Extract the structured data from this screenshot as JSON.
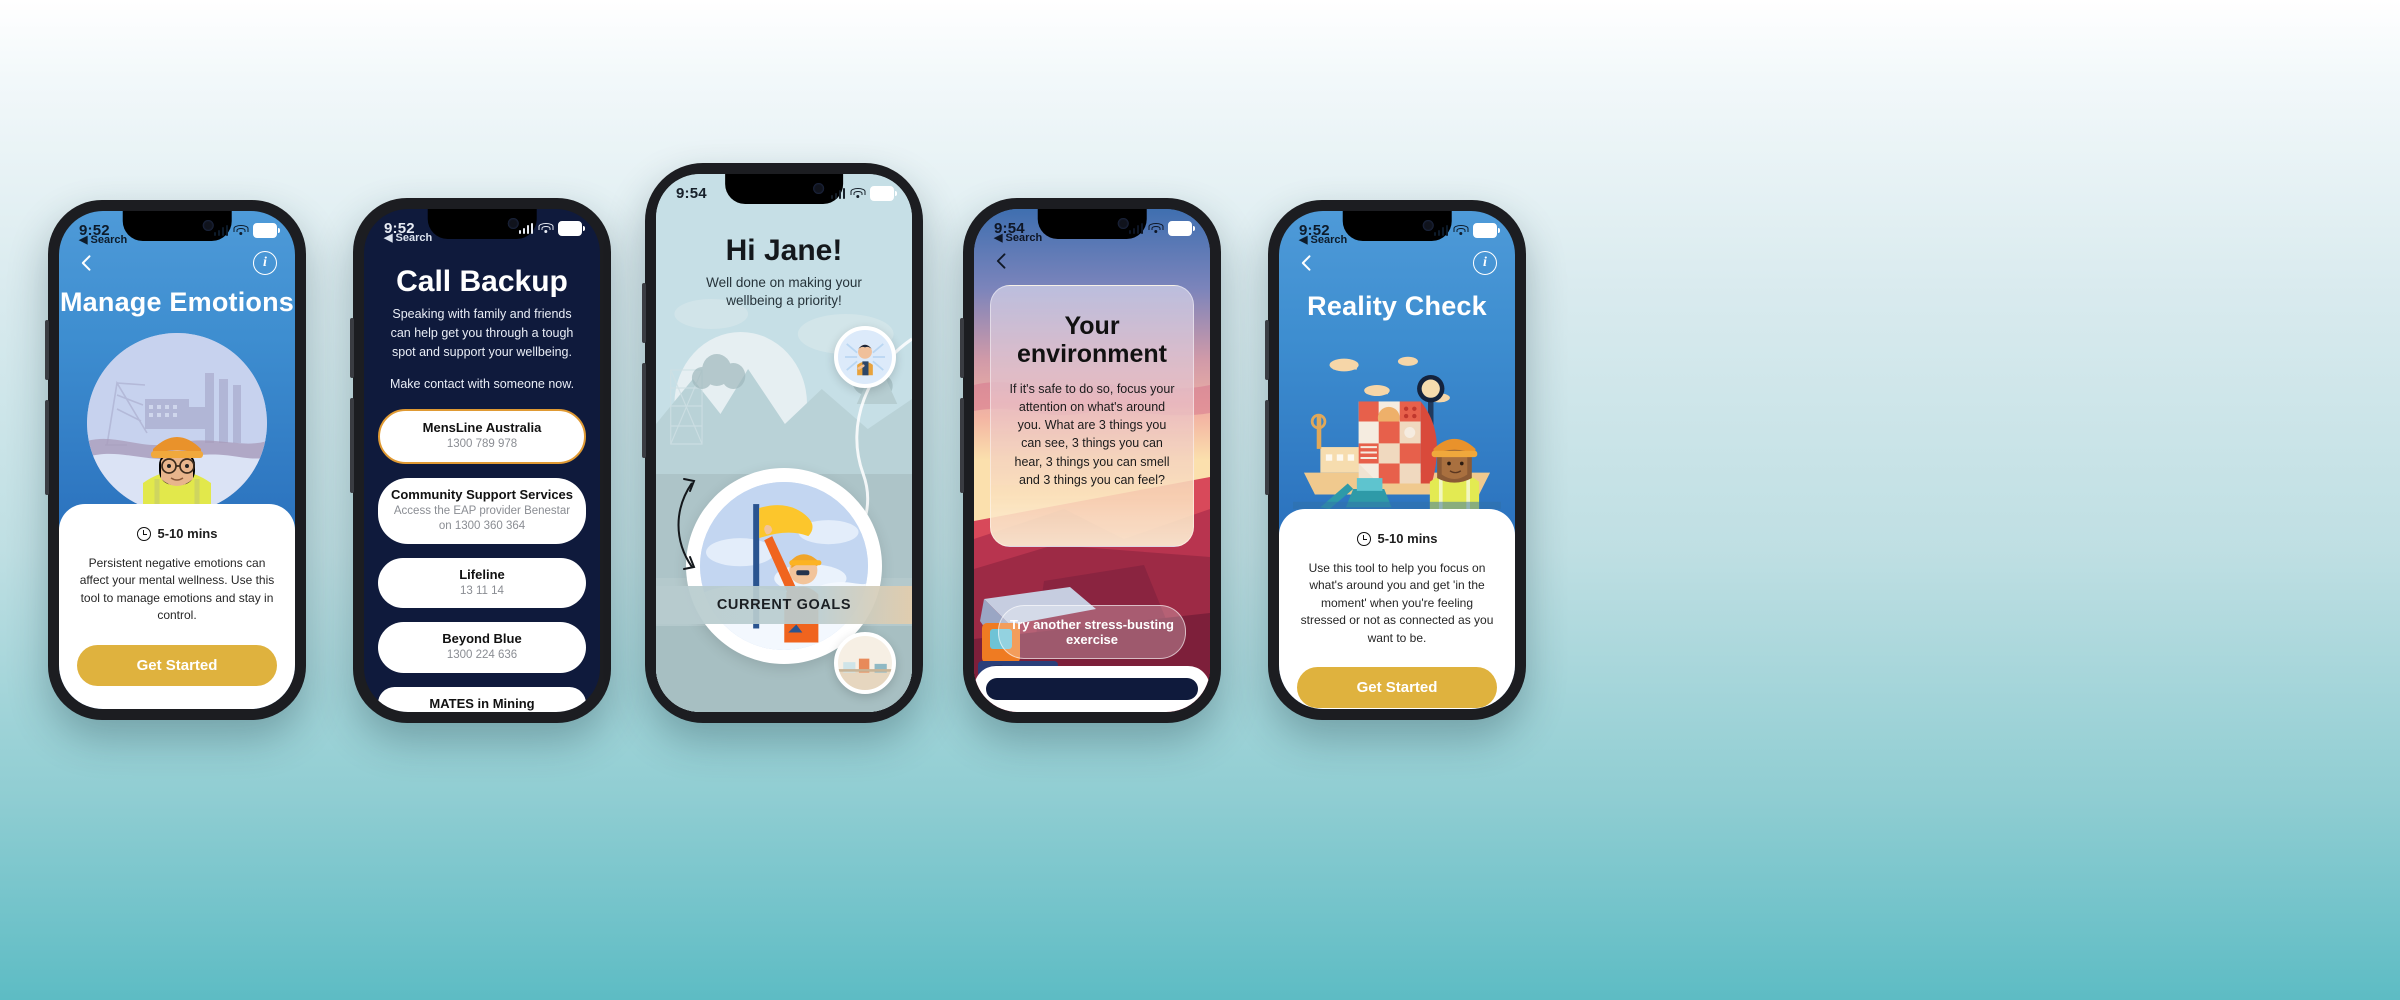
{
  "background": {
    "top_color": "#ffffff",
    "bottom_color": "#5dbcc4"
  },
  "phones": [
    {
      "id": "manage-emotions",
      "status": {
        "time": "9:52",
        "back_label": "◀ Search",
        "battery": "99",
        "wifi": "wifi-icon",
        "signal": "cellular-icon"
      },
      "nav": {
        "back_icon": "chevron-left-icon",
        "info_icon": "info-icon"
      },
      "title": "Manage Emotions",
      "illustration": "female-worker-hardhat-glasses-industrial-scene",
      "card": {
        "duration_icon": "clock-icon",
        "duration": "5-10 mins",
        "body": "Persistent negative emotions can affect your mental wellness. Use this tool to manage emotions and stay in control.",
        "cta": "Get Started"
      }
    },
    {
      "id": "call-backup",
      "status": {
        "time": "9:52",
        "back_label": "◀ Search",
        "battery": "99",
        "wifi": "wifi-icon",
        "signal": "cellular-icon"
      },
      "title": "Call Backup",
      "subtitle": "Speaking with family and friends can help get you through a tough spot and support your wellbeing.",
      "subtitle2": "Make contact with someone now.",
      "contacts": [
        {
          "name": "MensLine Australia",
          "detail": "1300 789 978",
          "highlighted": true
        },
        {
          "name": "Community Support Services",
          "detail": "Access the EAP provider Benestar on 1300 360 364",
          "highlighted": false
        },
        {
          "name": "Lifeline",
          "detail": "13 11 14",
          "highlighted": false
        },
        {
          "name": "Beyond Blue",
          "detail": "1300 224 636",
          "highlighted": false
        },
        {
          "name": "MATES in Mining",
          "detail": "",
          "highlighted": false
        }
      ]
    },
    {
      "id": "home-hi-jane",
      "status": {
        "time": "9:54",
        "battery": "98",
        "wifi": "wifi-icon",
        "signal": "cellular-icon"
      },
      "menu_icon": "more-options-icon",
      "greeting": "Hi Jane!",
      "subtitle": "Well done on making your wellbeing a priority!",
      "goal_illustration": "worker-raising-yellow-flag",
      "goals_bar_label": "CURRENT GOALS",
      "badges": [
        "man-pointing-at-self-badge",
        "workbench-badge"
      ],
      "path_icon": "curved-path-arrow-icon"
    },
    {
      "id": "your-environment",
      "status": {
        "time": "9:54",
        "back_label": "◀ Search",
        "battery": "99",
        "wifi": "wifi-icon",
        "signal": "cellular-icon"
      },
      "nav": {
        "back_icon": "chevron-left-icon"
      },
      "title": "Your environment",
      "body": "If it's safe to do so, focus your attention on what's around you. What are 3 things you can see, 3 things you can hear, 3 things you can smell and 3 things you can feel?",
      "cta": "Try another stress-busting exercise",
      "illustration": "mining-haul-truck-at-sunset-red-canyon"
    },
    {
      "id": "reality-check",
      "status": {
        "time": "9:52",
        "back_label": "◀ Search",
        "battery": "99",
        "wifi": "wifi-icon",
        "signal": "cellular-icon"
      },
      "nav": {
        "back_icon": "chevron-left-icon",
        "info_icon": "info-icon"
      },
      "title": "Reality Check",
      "illustration": "worker-with-laptop-port-cranes-abstract-face",
      "card": {
        "duration_icon": "clock-icon",
        "duration": "5-10 mins",
        "body": "Use this tool to help you focus on what's around you and get 'in the moment' when you're feeling stressed or not as connected as you want to be.",
        "cta": "Get Started"
      }
    }
  ]
}
